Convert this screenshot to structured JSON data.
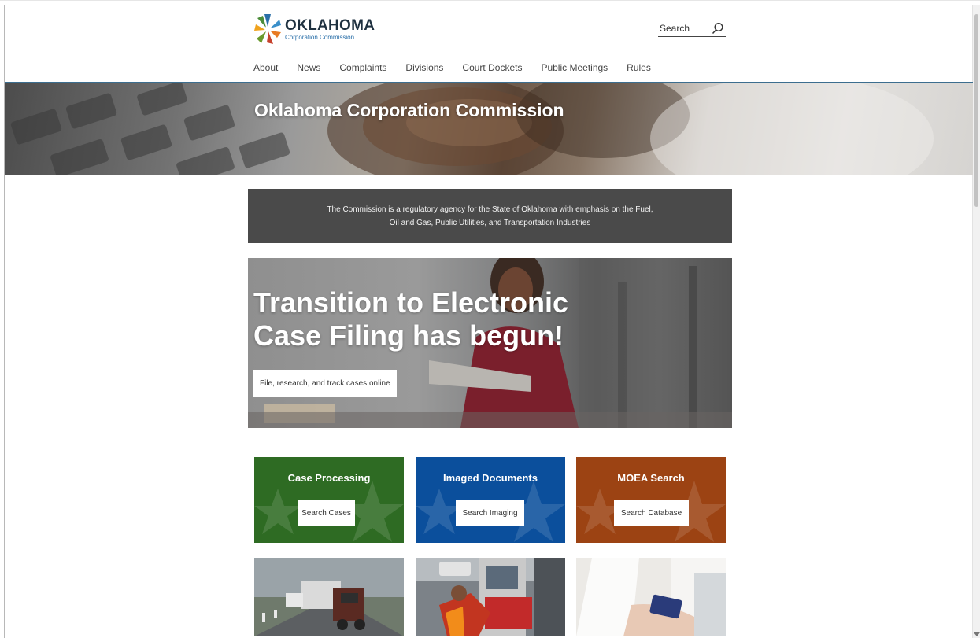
{
  "logo": {
    "title": "OKLAHOMA",
    "subtitle": "Corporation Commission"
  },
  "search": {
    "label": "Search"
  },
  "nav": {
    "items": [
      {
        "label": "About"
      },
      {
        "label": "News"
      },
      {
        "label": "Complaints"
      },
      {
        "label": "Divisions"
      },
      {
        "label": "Court Dockets"
      },
      {
        "label": "Public Meetings"
      },
      {
        "label": "Rules"
      }
    ]
  },
  "hero": {
    "title": "Oklahoma Corporation Commission"
  },
  "intro": {
    "text": "The Commission is a regulatory agency for the State of Oklahoma with emphasis on the Fuel, Oil and Gas, Public Utilities, and Transportation Industries"
  },
  "banner": {
    "title": "Transition to Electronic Case Filing has begun!",
    "button": "File, research, and track cases online"
  },
  "cards": [
    {
      "title": "Case Processing",
      "button": "Search Cases",
      "color": "#2e6b23"
    },
    {
      "title": "Imaged Documents",
      "button": "Search Imaging",
      "color": "#0b4f9c"
    },
    {
      "title": "MOEA Search",
      "button": "Search Database",
      "color": "#9c4313"
    }
  ],
  "photos": [
    {
      "icon": "truck-photo"
    },
    {
      "icon": "fuel-pump-photo"
    },
    {
      "icon": "credit-card-photo"
    }
  ],
  "colors": {
    "header_rule": "#3c6e8f",
    "intro_bg": "#4a4a4a"
  }
}
